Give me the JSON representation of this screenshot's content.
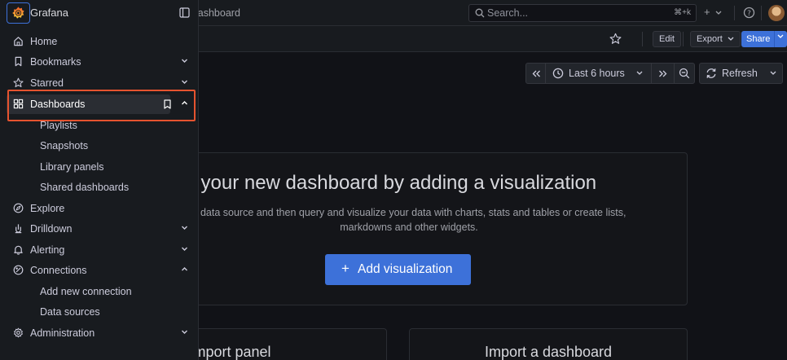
{
  "sidebar": {
    "brand": "Grafana",
    "items": [
      {
        "label": "Home",
        "icon": "home-icon"
      },
      {
        "label": "Bookmarks",
        "icon": "bookmark-icon"
      },
      {
        "label": "Starred",
        "icon": "star-icon"
      },
      {
        "label": "Dashboards",
        "icon": "apps-icon"
      },
      {
        "label": "Playlists"
      },
      {
        "label": "Snapshots"
      },
      {
        "label": "Library panels"
      },
      {
        "label": "Shared dashboards"
      },
      {
        "label": "Explore",
        "icon": "compass-icon"
      },
      {
        "label": "Drilldown",
        "icon": "drilldown-icon"
      },
      {
        "label": "Alerting",
        "icon": "bell-icon"
      },
      {
        "label": "Connections",
        "icon": "connections-icon"
      },
      {
        "label": "Add new connection"
      },
      {
        "label": "Data sources"
      },
      {
        "label": "Administration",
        "icon": "cog-icon"
      }
    ]
  },
  "topbar": {
    "breadcrumb": "lashboard",
    "search_placeholder": "Search...",
    "search_shortcut": "⌘+k",
    "new_label": "+"
  },
  "toolbar": {
    "edit_label": "Edit",
    "export_label": "Export",
    "share_label": "Share"
  },
  "time_controls": {
    "range_label": "Last 6 hours",
    "refresh_label": "Refresh"
  },
  "empty_state": {
    "title": "art your new dashboard by adding a visualization",
    "description_line1": "a data source and then query and visualize your data with charts, stats and tables or create lists,",
    "description_line2": "markdowns and other widgets.",
    "add_button_label": "Add visualization"
  },
  "cards": {
    "import_panel": "Import panel",
    "import_dashboard": "Import a dashboard"
  },
  "colors": {
    "accent": "#3d71d9",
    "highlight": "#e5532f",
    "background": "#111217",
    "panel": "#181b1f"
  }
}
